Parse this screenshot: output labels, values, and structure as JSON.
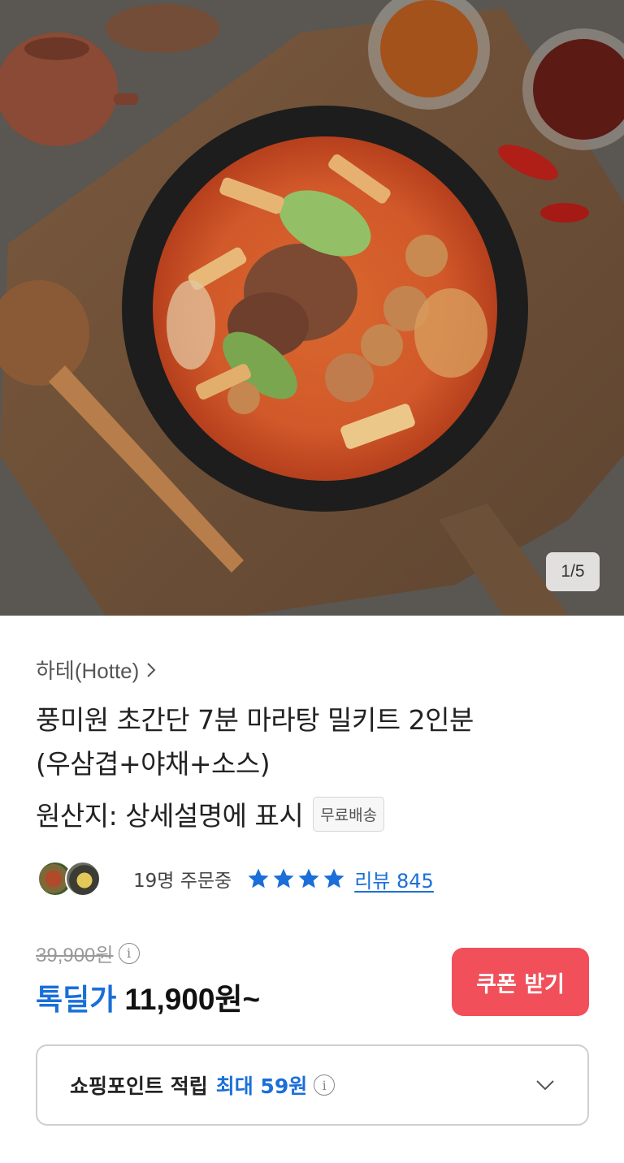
{
  "gallery": {
    "pager": "1/5",
    "image_alt": "마라탕 상품 이미지"
  },
  "product": {
    "brand": "하테(Hotte)",
    "title_line1": "풍미원 초간단 7분 마라탕 밀키트 2인분",
    "title_line2": "(우삼겹+야채+소스)",
    "origin": "원산지: 상세설명에 표시",
    "free_shipping_badge": "무료배송"
  },
  "social": {
    "orders": "19명 주문중",
    "rating_stars": 4,
    "review_link": "리뷰 845"
  },
  "pricing": {
    "original_price": "39,900원",
    "deal_label": "톡딜가",
    "deal_price": "11,900원~",
    "coupon_button": "쿠폰 받기"
  },
  "points": {
    "label": "쇼핑포인트 적립",
    "max": "최대 59원"
  },
  "colors": {
    "accent_blue": "#1a6fd8",
    "coupon_red": "#f14f5a"
  },
  "icons": {
    "brand_chevron": "chevron-right-icon",
    "star": "star-icon",
    "info": "info-icon",
    "expand": "chevron-down-icon"
  }
}
